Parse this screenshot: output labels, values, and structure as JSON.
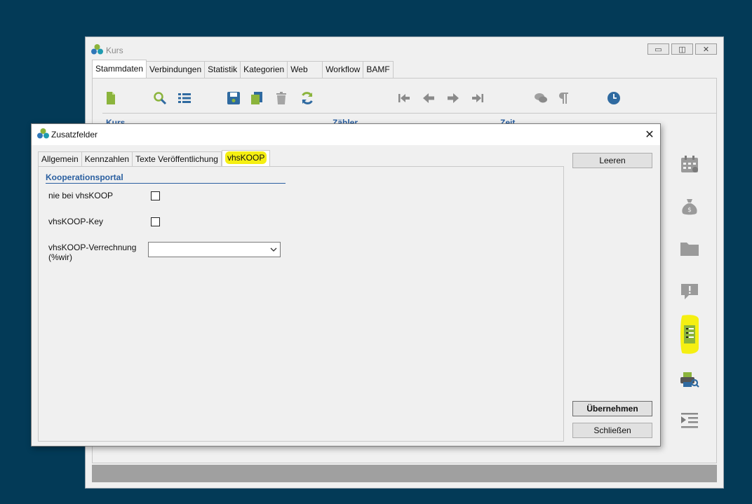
{
  "main_window": {
    "title": "Kurs",
    "tabs": [
      "Stammdaten",
      "Verbindungen",
      "Statistik",
      "Kategorien",
      "Web",
      "Workflow",
      "BAMF"
    ],
    "active_tab": "Stammdaten",
    "column_headers": [
      "Kurs",
      "Zähler",
      "Zeit"
    ],
    "toolbar_icons": [
      "new-document-icon",
      "search-icon",
      "list-icon",
      "save-icon",
      "copy-icon",
      "delete-icon",
      "refresh-icon",
      "first-record-icon",
      "previous-record-icon",
      "next-record-icon",
      "last-record-icon",
      "comments-icon",
      "paragraph-icon",
      "clock-icon"
    ],
    "side_icons": [
      "calendar-icon",
      "money-bag-icon",
      "folder-icon",
      "notice-icon",
      "checklist-icon",
      "print-preview-icon",
      "indent-list-icon"
    ]
  },
  "dialog": {
    "title": "Zusatzfelder",
    "tabs": [
      "Allgemein",
      "Kennzahlen",
      "Texte Veröffentlichung",
      "vhsKOOP"
    ],
    "active_tab": "vhsKOOP",
    "section_title": "Kooperationsportal",
    "fields": {
      "nie_bei_vhskoop": {
        "label": "nie bei vhsKOOP",
        "checked": false
      },
      "vhskoop_key": {
        "label": "vhsKOOP-Key",
        "checked": false
      },
      "verrechnung": {
        "label_line1": "vhsKOOP-Verrechnung",
        "label_line2": "(%wir)",
        "value": ""
      }
    },
    "buttons": {
      "clear": "Leeren",
      "apply": "Übernehmen",
      "close": "Schließen"
    }
  },
  "colors": {
    "desktop": "#033a57",
    "accent_blue": "#2a5fa0",
    "icon_green": "#8bb43c",
    "highlight": "#f5ef12"
  }
}
